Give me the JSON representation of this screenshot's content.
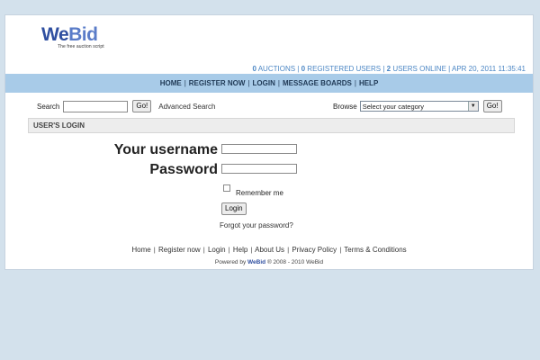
{
  "logo": {
    "part1": "We",
    "part2": "Bid",
    "tagline": "The free auction script"
  },
  "stats": {
    "auctions_count": "0",
    "auctions_label": "AUCTIONS",
    "users_count": "0",
    "users_label": "REGISTERED USERS",
    "online_count": "2",
    "online_label": "USERS ONLINE",
    "datetime": "APR 20, 2011 11:35:41"
  },
  "nav": {
    "items": [
      "HOME",
      "REGISTER NOW",
      "LOGIN",
      "MESSAGE BOARDS",
      "HELP"
    ],
    "separator": "|"
  },
  "search": {
    "label": "Search",
    "value": "",
    "go_label": "Go!",
    "advanced_label": "Advanced Search"
  },
  "browse": {
    "label": "Browse",
    "selected": "Select your category",
    "go_label": "Go!"
  },
  "section": {
    "title": "USER'S LOGIN"
  },
  "login_form": {
    "username_label": "Your username",
    "username_value": "",
    "password_label": "Password",
    "password_value": "",
    "remember_label": "Remember me",
    "remember_checked": false,
    "submit_label": "Login",
    "forgot_label": "Forgot your password?"
  },
  "footer": {
    "links": [
      "Home",
      "Register now",
      "Login",
      "Help",
      "About Us",
      "Privacy Policy",
      "Terms & Conditions"
    ],
    "separator": "|",
    "powered_prefix": "Powered by",
    "powered_brand": "WeBid",
    "powered_suffix": "® 2008 - 2010",
    "powered_brand2": "WeBid"
  },
  "colors": {
    "page_background": "#d3e1ec",
    "nav_background": "#a8cbe8",
    "stats_text": "#4b86c4",
    "logo_we": "#2f4fa0",
    "logo_bid": "#5a7cc8"
  }
}
